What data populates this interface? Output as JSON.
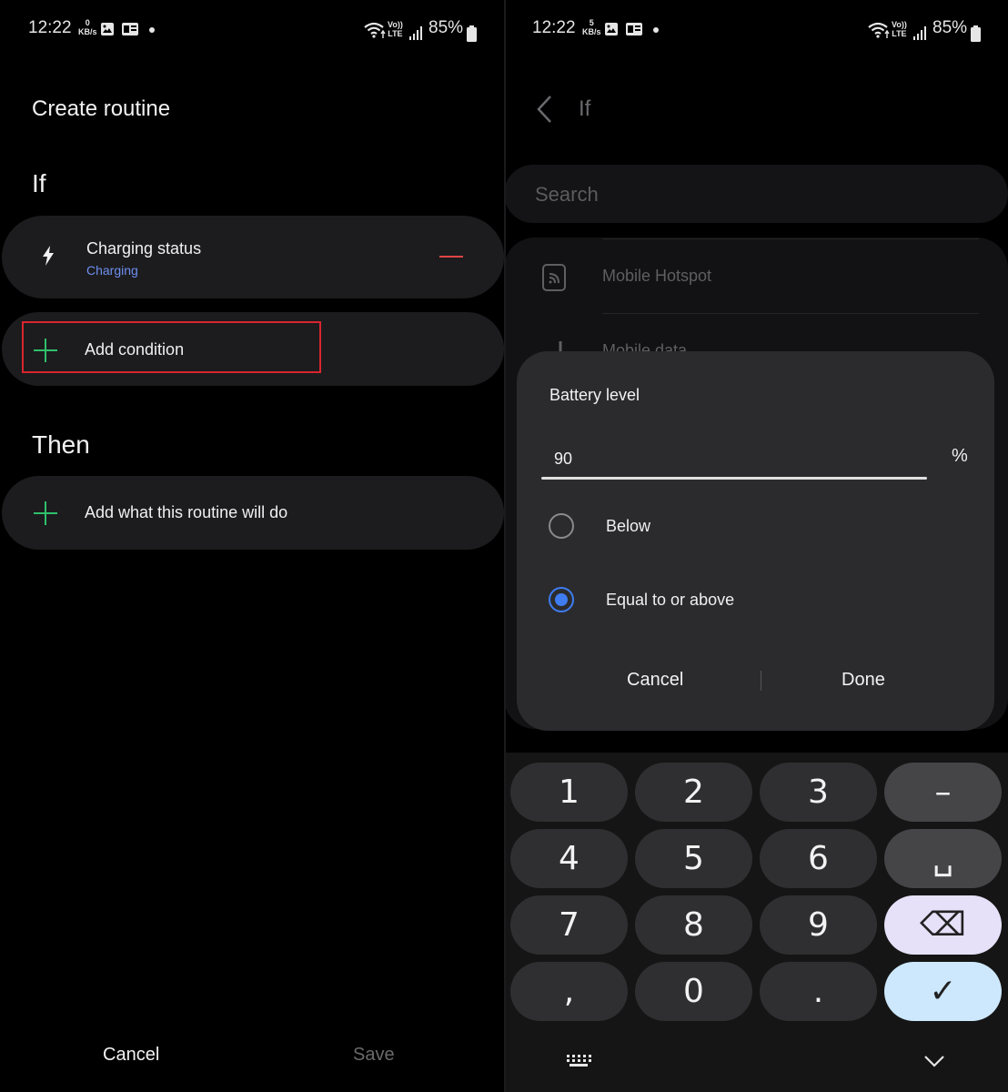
{
  "status_bar": {
    "left": {
      "time": "12:22",
      "speed_value": "0",
      "speed_unit": "KB/s",
      "battery": "85%"
    },
    "right": {
      "time": "12:22",
      "speed_value": "5",
      "speed_unit": "KB/s",
      "battery": "85%"
    },
    "network_label_top": "Vo))",
    "network_label_bottom": "LTE"
  },
  "left_screen": {
    "title": "Create routine",
    "if_heading": "If",
    "condition": {
      "title": "Charging status",
      "subtitle": "Charging"
    },
    "add_condition_label": "Add condition",
    "then_heading": "Then",
    "add_action_label": "Add what this routine will do",
    "cancel_label": "Cancel",
    "save_label": "Save"
  },
  "right_screen": {
    "title": "If",
    "search_placeholder": "Search",
    "bg_items": [
      "Mobile Hotspot",
      "Mobile data"
    ],
    "dialog": {
      "title": "Battery level",
      "value": "90",
      "unit": "%",
      "options": [
        "Below",
        "Equal to or above"
      ],
      "selected_option": "Equal to or above",
      "cancel_label": "Cancel",
      "done_label": "Done"
    },
    "keypad": {
      "keys": [
        "1",
        "2",
        "3",
        "–",
        "4",
        "5",
        "6",
        "␣",
        "7",
        "8",
        "9",
        "⌫",
        ",",
        "0",
        ".",
        "✓"
      ]
    }
  },
  "colors": {
    "accent_blue": "#3e7cf0",
    "accent_green": "#2fbf6b",
    "remove_red": "#e14545",
    "highlight_red": "#d9252f",
    "subtitle_blue": "#6f8ff0"
  }
}
